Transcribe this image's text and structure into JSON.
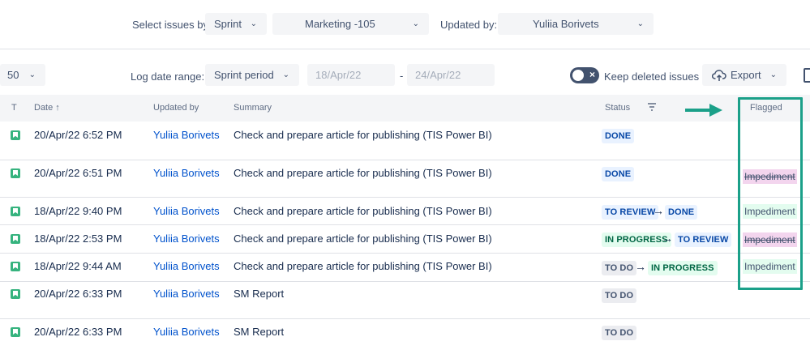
{
  "filters": {
    "select_label": "Select issues by:",
    "select_by_value": "Sprint",
    "sprint_value": "Marketing -105",
    "updated_by_label": "Updated by:",
    "updated_by_value": "Yuliia Borivets"
  },
  "toolbar": {
    "page_size": "50",
    "log_date_label": "Log date range:",
    "log_date_value": "Sprint period",
    "date_from": "18/Apr/22",
    "date_sep": "-",
    "date_to": "24/Apr/22",
    "keep_deleted_label": "Keep deleted issues",
    "export_label": "Export"
  },
  "columns": {
    "type": "T",
    "date": "Date ↑",
    "updated_by": "Updated by",
    "summary": "Summary",
    "status": "Status",
    "flagged": "Flagged"
  },
  "rows": [
    {
      "date": "20/Apr/22 6:52 PM",
      "user": "Yuliia Borivets",
      "summary": "Check and prepare article for publishing (TIS Power BI)",
      "status_from": "DONE",
      "status_to": "",
      "flag": ""
    },
    {
      "date": "20/Apr/22 6:51 PM",
      "user": "Yuliia Borivets",
      "summary": "Check and prepare article for publishing (TIS Power BI)",
      "status_from": "DONE",
      "status_to": "",
      "flag": "Impediment"
    },
    {
      "date": "18/Apr/22 9:40 PM",
      "user": "Yuliia Borivets",
      "summary": "Check and prepare article for publishing (TIS Power BI)",
      "status_from": "TO REVIEW",
      "status_to": "DONE",
      "flag": "Impediment"
    },
    {
      "date": "18/Apr/22 2:53 PM",
      "user": "Yuliia Borivets",
      "summary": "Check and prepare article for publishing (TIS Power BI)",
      "status_from": "IN PROGRESS",
      "status_to": "TO REVIEW",
      "flag": "Impediment"
    },
    {
      "date": "18/Apr/22 9:44 AM",
      "user": "Yuliia Borivets",
      "summary": "Check and prepare article for publishing (TIS Power BI)",
      "status_from": "TO DO",
      "status_to": "IN PROGRESS",
      "flag": "Impediment"
    },
    {
      "date": "20/Apr/22 6:33 PM",
      "user": "Yuliia Borivets",
      "summary": "SM Report",
      "status_from": "TO DO",
      "status_to": "",
      "flag": ""
    },
    {
      "date": "20/Apr/22 6:33 PM",
      "user": "Yuliia Borivets",
      "summary": "SM Report",
      "status_from": "TO DO",
      "status_to": "",
      "flag": ""
    }
  ],
  "colors": {
    "highlight": "#1ba089",
    "link": "#0052cc"
  }
}
